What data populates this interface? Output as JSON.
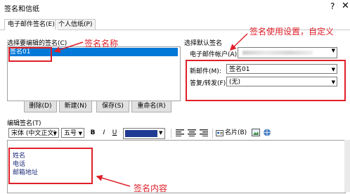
{
  "window": {
    "title": "签名和信纸",
    "help_label": "?",
    "close_label": "✕"
  },
  "tabs": [
    {
      "label": "电子邮件签名(E)",
      "active": true
    },
    {
      "label": "个人信纸(P)",
      "active": false
    }
  ],
  "left": {
    "list_label": "选择要编辑的签名(C)",
    "items": [
      "签名01"
    ],
    "buttons": {
      "delete": "删除(D)",
      "new": "新建(N)",
      "save": "保存(S)",
      "rename": "重命名(R)"
    }
  },
  "right": {
    "section_label": "选择默认签名",
    "account_label": "电子邮件帐户(A):",
    "new_messages_label": "新邮件(M):",
    "new_messages_value": "签名01",
    "reply_label": "答复/转发(F):",
    "reply_value": "(无)"
  },
  "editor": {
    "label": "编辑签名(T)",
    "font_value": "宋体 (中文正文)",
    "size_value": "五号",
    "bold": "B",
    "italic": "I",
    "underline": "U",
    "font_color": "#1f3a93",
    "business_card": "名片(B)",
    "lines": [
      "姓名",
      "电话",
      "邮箱地址"
    ]
  },
  "annotations": {
    "name_note": "签名名称",
    "settings_note": "签名使用设置，自定义",
    "content_note": "签名内容",
    "color": "#e0202a"
  }
}
